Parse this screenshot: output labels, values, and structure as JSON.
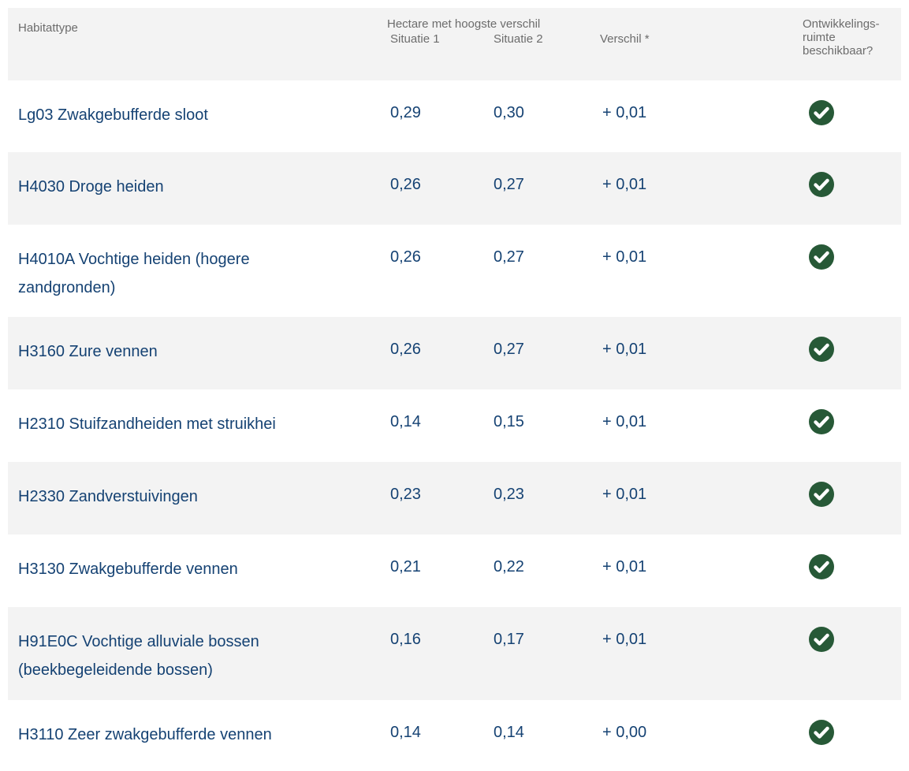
{
  "header": {
    "habitattype": "Habitattype",
    "hectare": "Hectare met hoogste verschil",
    "situatie1": "Situatie 1",
    "situatie2": "Situatie 2",
    "verschil": "Verschil *",
    "ontwikkelingsruimte_1": "Ontwikkelings-",
    "ontwikkelingsruimte_2": "ruimte",
    "ontwikkelingsruimte_3": "beschikbaar?"
  },
  "colors": {
    "text": "#154273",
    "header_text": "#6c6c6c",
    "stripe": "#f3f3f3",
    "check": "#275937"
  },
  "rows": [
    {
      "type": "Lg03 Zwakgebufferde sloot",
      "s1": "0,29",
      "s2": "0,30",
      "verschil": "+ 0,01",
      "icon": "check-circle-icon"
    },
    {
      "type": "H4030 Droge heiden",
      "s1": "0,26",
      "s2": "0,27",
      "verschil": "+ 0,01",
      "icon": "check-circle-icon"
    },
    {
      "type": "H4010A Vochtige heiden (hogere zandgronden)",
      "s1": "0,26",
      "s2": "0,27",
      "verschil": "+ 0,01",
      "icon": "check-circle-icon"
    },
    {
      "type": "H3160 Zure vennen",
      "s1": "0,26",
      "s2": "0,27",
      "verschil": "+ 0,01",
      "icon": "check-circle-icon"
    },
    {
      "type": "H2310 Stuifzandheiden met struikhei",
      "s1": "0,14",
      "s2": "0,15",
      "verschil": "+ 0,01",
      "icon": "check-circle-icon"
    },
    {
      "type": "H2330 Zandverstuivingen",
      "s1": "0,23",
      "s2": "0,23",
      "verschil": "+ 0,01",
      "icon": "check-circle-icon"
    },
    {
      "type": "H3130 Zwakgebufferde vennen",
      "s1": "0,21",
      "s2": "0,22",
      "verschil": "+ 0,01",
      "icon": "check-circle-icon"
    },
    {
      "type": "H91E0C Vochtige alluviale bossen (beekbegeleidende bossen)",
      "s1": "0,16",
      "s2": "0,17",
      "verschil": "+ 0,01",
      "icon": "check-circle-icon"
    },
    {
      "type": "H3110 Zeer zwakgebufferde vennen",
      "s1": "0,14",
      "s2": "0,14",
      "verschil": "+ 0,00",
      "icon": "check-circle-icon"
    }
  ]
}
